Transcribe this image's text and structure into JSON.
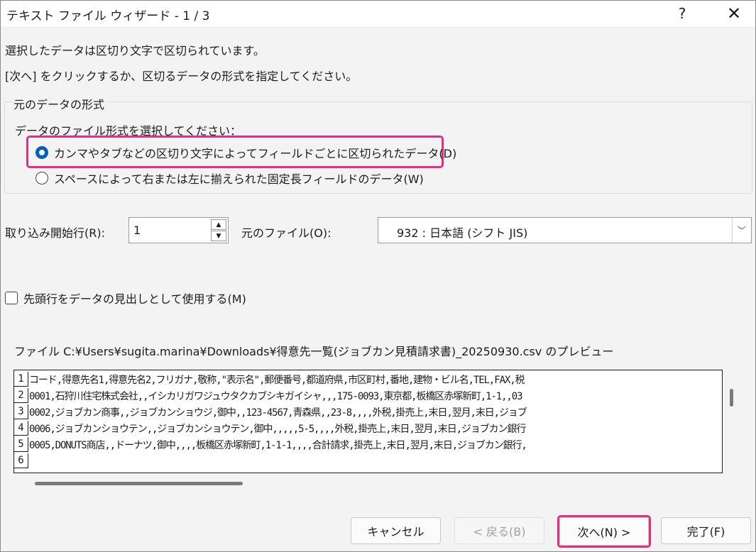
{
  "window": {
    "title": "テキスト ファイル ウィザード - 1 / 3",
    "help_label": "?",
    "close_label": "✕"
  },
  "description": {
    "line1": "選択したデータは区切り文字で区切られています。",
    "line2": "[次へ] をクリックするか、区切るデータの形式を指定してください。"
  },
  "format_group": {
    "legend": "元のデータの形式",
    "prompt": "データのファイル形式を選択してください：",
    "options": [
      {
        "label": "カンマやタブなどの区切り文字によってフィールドごとに区切られたデータ(D)",
        "selected": true
      },
      {
        "label": "スペースによって右または左に揃えられた固定長フィールドのデータ(W)",
        "selected": false
      }
    ]
  },
  "start_row": {
    "label": "取り込み開始行(R):",
    "value": "1"
  },
  "origin": {
    "label": "元のファイル(O):",
    "value": "932 : 日本語 (シフト JIS)"
  },
  "header_checkbox": {
    "label": "先頭行をデータの見出しとして使用する(M)",
    "checked": false
  },
  "preview": {
    "label": "ファイル C:¥Users¥sugita.marina¥Downloads¥得意先一覧(ジョブカン見積請求書)_20250930.csv のプレビュー",
    "rows": [
      {
        "num": "1",
        "text": "コード,得意先名1,得意先名2,フリガナ,敬称,\"表示名\",郵便番号,都道府県,市区町村,番地,建物・ビル名,TEL,FAX,税"
      },
      {
        "num": "2",
        "text": "0001,石狩川住宅株式会社,,イシカリガワジュウタクカブシキガイシャ,,,175-0093,東京都,板橋区赤塚新町,1-1,,03"
      },
      {
        "num": "3",
        "text": "0002,ジョブカン商事,,ジョブカンショウジ,御中,,123-4567,青森県,,23-8,,,,外税,掛売上,末日,翌月,末日,ジョブ"
      },
      {
        "num": "4",
        "text": "0006,ジョブカンショウテン,,ジョブカンショウテン,御中,,,,,5-5,,,,外税,掛売上,末日,翌月,末日,ジョブカン銀行"
      },
      {
        "num": "5",
        "text": "0005,DONUTS商店,,ドーナツ,御中,,,,板橋区赤塚新町,1-1-1,,,,合計請求,掛売上,末日,翌月,末日,ジョブカン銀行,"
      },
      {
        "num": "6",
        "text": ""
      }
    ]
  },
  "buttons": {
    "cancel": "キャンセル",
    "back": "< 戻る(B)",
    "next": "次へ(N) >",
    "finish": "完了(F)"
  },
  "colors": {
    "highlight": "#e0307f",
    "accent": "#005fb8"
  }
}
